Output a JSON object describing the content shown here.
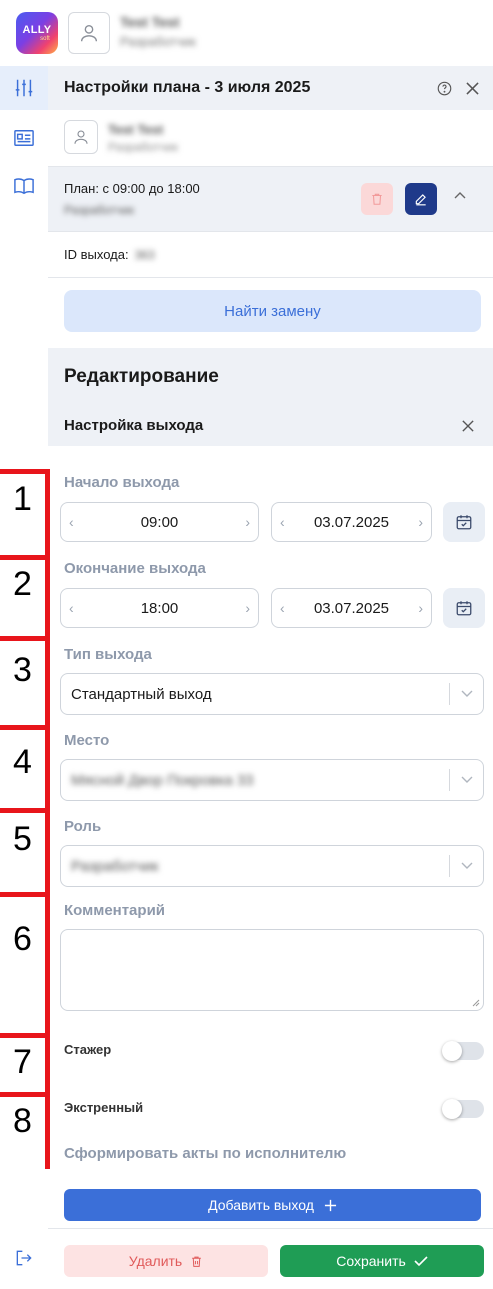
{
  "app": {
    "logo_text": "ALLY",
    "logo_sub": "soft",
    "user_name": "Test Test",
    "user_role": "Разработчик"
  },
  "sidebar": {
    "items": [
      {
        "icon": "sliders-icon",
        "active": true
      },
      {
        "icon": "id-card-icon",
        "active": false
      },
      {
        "icon": "book-icon",
        "active": false
      }
    ],
    "bottom_icon": "logout-icon"
  },
  "panel": {
    "title": "Настройки плана - 3 июля 2025",
    "person_name": "Test Test",
    "person_role": "Разработчик",
    "plan_label": "План: с 09:00 до 18:00",
    "plan_role": "Разработчик",
    "id_label": "ID выхода:",
    "id_value": "363",
    "find_replacement": "Найти замену"
  },
  "edit": {
    "section_title": "Редактирование",
    "sub_title": "Настройка выхода",
    "start_label": "Начало выхода",
    "start_time": "09:00",
    "start_date": "03.07.2025",
    "end_label": "Окончание выхода",
    "end_time": "18:00",
    "end_date": "03.07.2025",
    "type_label": "Тип выхода",
    "type_value": "Стандартный выход",
    "place_label": "Место",
    "place_value": "Мясной Двор Покровка 33",
    "role_label": "Роль",
    "role_value": "Разработчик",
    "comment_label": "Комментарий",
    "comment_value": "",
    "intern_label": "Стажер",
    "intern_on": false,
    "urgent_label": "Экстренный",
    "urgent_on": false,
    "acts_label": "Сформировать акты по исполнителю",
    "add_button": "Добавить выход"
  },
  "footer": {
    "delete": "Удалить",
    "save": "Сохранить"
  },
  "annotations": {
    "n1": "1",
    "n2": "2",
    "n3": "3",
    "n4": "4",
    "n5": "5",
    "n6": "6",
    "n7": "7",
    "n8": "8"
  },
  "colors": {
    "accent": "#3b6fd8",
    "save": "#1f9d55",
    "danger": "#e05a5a",
    "annotation": "#e8151b"
  }
}
